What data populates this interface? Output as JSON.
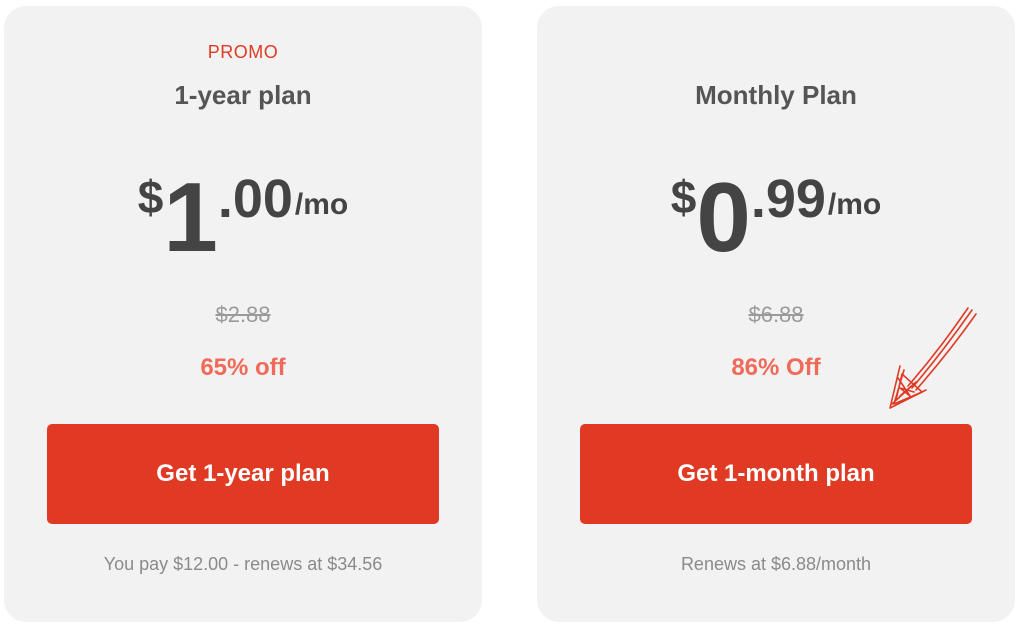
{
  "plans": [
    {
      "promo_label": "PROMO",
      "title": "1-year plan",
      "currency": "$",
      "price_whole": "1",
      "price_decimal": ".00",
      "period": "/mo",
      "original_price": "$2.88",
      "discount": "65% off",
      "cta_label": "Get 1-year plan",
      "note": "You pay $12.00 - renews at $34.56"
    },
    {
      "title": "Monthly Plan",
      "currency": "$",
      "price_whole": "0",
      "price_decimal": ".99",
      "period": "/mo",
      "original_price": "$6.88",
      "discount": "86% Off",
      "cta_label": "Get 1-month plan",
      "note": "Renews at $6.88/month"
    }
  ],
  "colors": {
    "accent": "#e03a25",
    "discount": "#f06a5a",
    "card_bg": "#f2f2f2",
    "title": "#555555",
    "muted": "#8a8a8a"
  },
  "annotation": {
    "icon": "hand-drawn-arrow-icon"
  }
}
